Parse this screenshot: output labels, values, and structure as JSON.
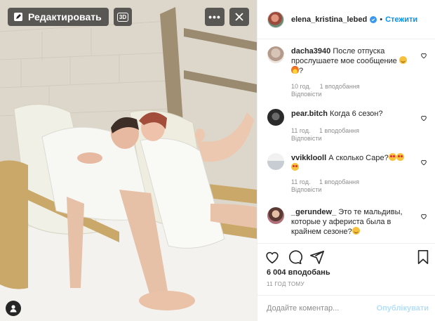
{
  "photo_toolbar": {
    "edit_label": "Редактировать",
    "badge_3d": "3D"
  },
  "post": {
    "username": "elena_kristina_lebed",
    "dot": "•",
    "follow_label": "Стежити",
    "likes": "6 004 вподобань",
    "time": "11 ГОД ТОМУ",
    "comment_placeholder": "Додайте коментар...",
    "publish_label": "Опублікувати"
  },
  "comments": [
    {
      "user": "dacha3940",
      "text": "После отпуска прослушаете мое сообщение",
      "emoji": [
        "smile",
        "fire"
      ],
      "time": "10 год.",
      "likes": "1 вподобання",
      "reply": "Відповісти"
    },
    {
      "user": "pear.bitch",
      "text": "Когда 6 сезон?",
      "emoji": [],
      "time": "11 год.",
      "likes": "1 вподобання",
      "reply": "Відповісти"
    },
    {
      "user": "vvikklooll",
      "text": "А сколько Саре?",
      "emoji": [
        "heart-eyes",
        "heart-eyes",
        "heart-eyes"
      ],
      "time": "11 год.",
      "likes": "1 вподобання",
      "reply": "Відповісти"
    },
    {
      "user": "_gerundew_",
      "text": "Это те мальдивы, которые у афериста была в крайнем сезоне?",
      "emoji": [
        "sweat-smile"
      ],
      "time": "",
      "likes": "",
      "reply": ""
    }
  ],
  "colors": {
    "accent": "#0095f6",
    "verified": "#3897f0",
    "muted": "#8e8e8e"
  },
  "icons": [
    "edit-icon",
    "3d-icon",
    "more-icon",
    "close-icon",
    "user-tag-icon",
    "heart-icon",
    "comment-icon",
    "share-icon",
    "bookmark-icon",
    "verified-icon"
  ]
}
